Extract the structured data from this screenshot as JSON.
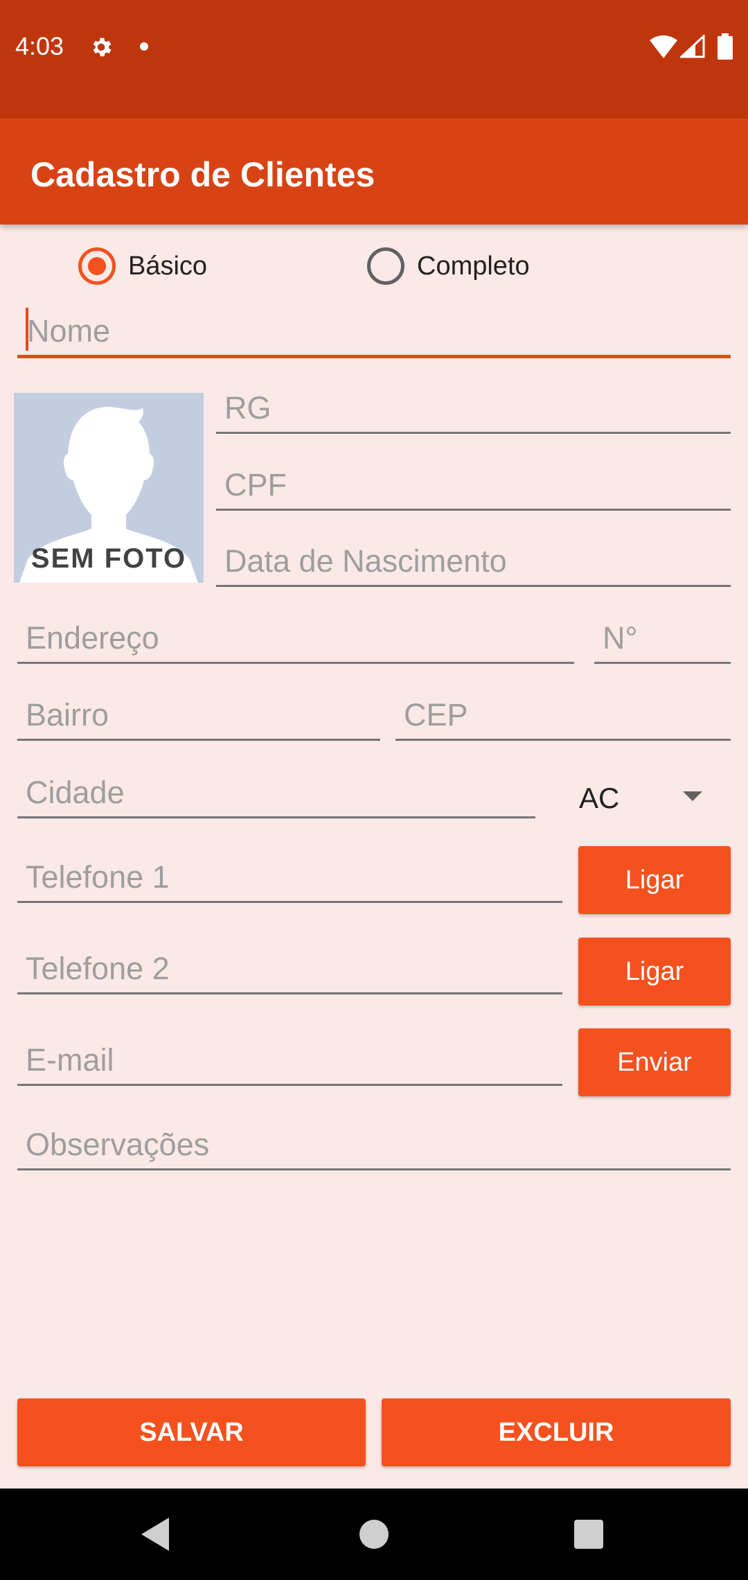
{
  "status_bar": {
    "time": "4:03"
  },
  "app_bar": {
    "title": "Cadastro de Clientes"
  },
  "mode": {
    "options": [
      "Básico",
      "Completo"
    ],
    "selected": "Básico"
  },
  "form": {
    "nome": "Nome",
    "rg": "RG",
    "cpf": "CPF",
    "data_nascimento": "Data de Nascimento",
    "endereco": "Endereço",
    "numero": "N°",
    "bairro": "Bairro",
    "cep": "CEP",
    "cidade": "Cidade",
    "estado": "AC",
    "telefone1": "Telefone 1",
    "telefone2": "Telefone 2",
    "email": "E-mail",
    "observacoes": "Observações"
  },
  "photo": {
    "label": "SEM FOTO"
  },
  "buttons": {
    "ligar1": "Ligar",
    "ligar2": "Ligar",
    "enviar": "Enviar",
    "salvar": "SALVAR",
    "excluir": "EXCLUIR"
  },
  "colors": {
    "status_bar": "#bf360c",
    "app_bar": "#d84315",
    "accent": "#f4511e",
    "background": "#fbe9e7"
  }
}
